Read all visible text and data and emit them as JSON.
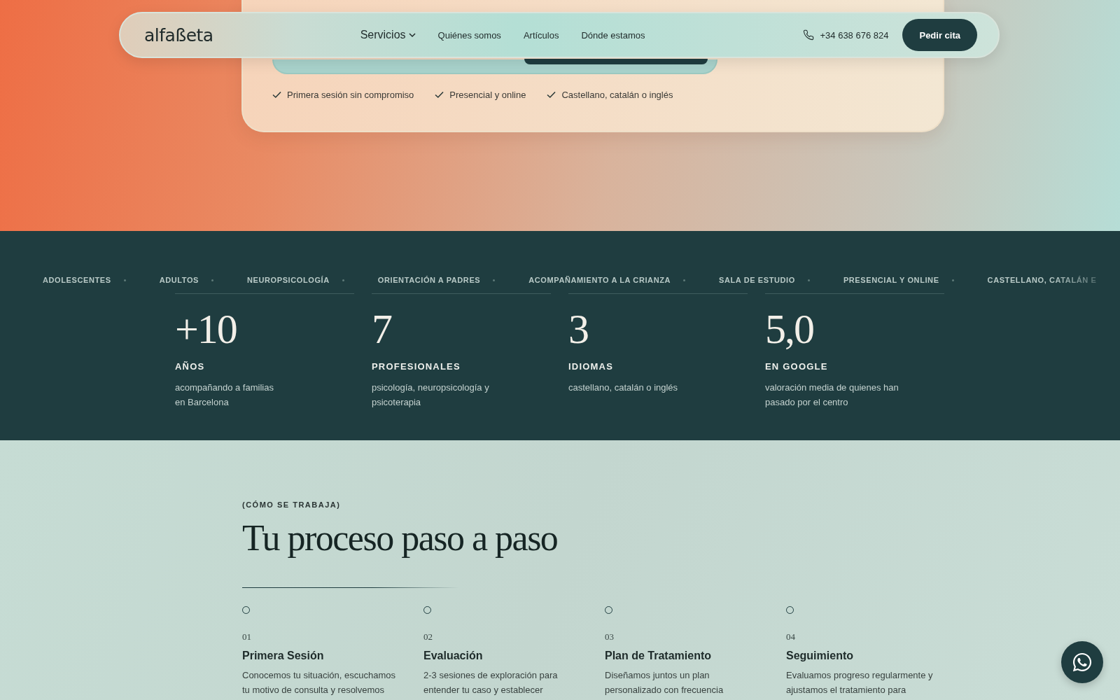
{
  "nav": {
    "logo": "alfaßeta",
    "links": [
      {
        "label": "Servicios",
        "dropdown": true
      },
      {
        "label": "Quiénes somos",
        "dropdown": false
      },
      {
        "label": "Artículos",
        "dropdown": false
      },
      {
        "label": "Dónde estamos",
        "dropdown": false
      }
    ],
    "phone": "+34 638 676 824",
    "cta": "Pedir cita"
  },
  "hero_card": {
    "checks": [
      "Primera sesión sin compromiso",
      "Presencial y online",
      "Castellano, catalán o inglés"
    ]
  },
  "marquee": [
    "ADOLESCENTES",
    "ADULTOS",
    "NEUROPSICOLOGÍA",
    "ORIENTACIÓN A PADRES",
    "ACOMPAÑAMIENTO A LA CRIANZA",
    "SALA DE ESTUDIO",
    "PRESENCIAL Y ONLINE",
    "CASTELLANO, CATALÁN E"
  ],
  "stats": [
    {
      "value": "+10",
      "label": "AÑOS",
      "description": "acompañando a familias\nen Barcelona"
    },
    {
      "value": "7",
      "label": "PROFESIONALES",
      "description": "psicología, neuropsicología y\npsicoterapia"
    },
    {
      "value": "3",
      "label": "IDIOMAS",
      "description": "castellano, catalán o inglés"
    },
    {
      "value": "5,0",
      "label": "EN GOOGLE",
      "description": "valoración media de quienes han\npasado por el centro"
    }
  ],
  "process": {
    "eyebrow": "(CÓMO SE TRABAJA)",
    "title": "Tu proceso paso a paso",
    "steps": [
      {
        "number": "01",
        "title": "Primera Sesión",
        "description": "Conocemos tu situación, escuchamos\ntu motivo de consulta y resolvemos"
      },
      {
        "number": "02",
        "title": "Evaluación",
        "description": "2-3 sesiones de exploración para\nentender tu caso y establecer"
      },
      {
        "number": "03",
        "title": "Plan de Tratamiento",
        "description": "Diseñamos juntos un plan\npersonalizado con frecuencia"
      },
      {
        "number": "04",
        "title": "Seguimiento",
        "description": "Evaluamos progreso regularmente y\najustamos el tratamiento para"
      }
    ]
  }
}
